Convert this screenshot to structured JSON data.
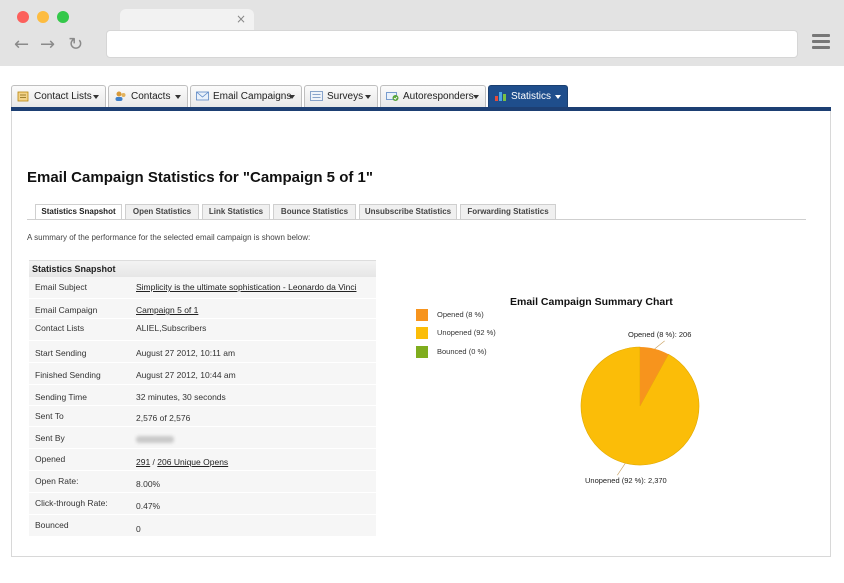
{
  "browser": {
    "tab_close": "×",
    "back_icon": "←",
    "forward_icon": "→",
    "reload_icon": "↻"
  },
  "app_tabs": [
    {
      "label": "Contact Lists",
      "icon": "contact-lists-icon"
    },
    {
      "label": "Contacts",
      "icon": "contacts-icon"
    },
    {
      "label": "Email Campaigns",
      "icon": "envelope-icon"
    },
    {
      "label": "Surveys",
      "icon": "survey-form-icon"
    },
    {
      "label": "Autoresponders",
      "icon": "autoresponder-icon"
    },
    {
      "label": "Statistics",
      "icon": "bar-chart-icon",
      "active": true
    }
  ],
  "page_title": "Email Campaign Statistics for \"Campaign 5 of 1\"",
  "sub_tabs": [
    "Statistics Snapshot",
    "Open Statistics",
    "Link Statistics",
    "Bounce Statistics",
    "Unsubscribe Statistics",
    "Forwarding Statistics"
  ],
  "summary_text": "A summary of the performance for the selected email campaign is shown below:",
  "snapshot": {
    "heading": "Statistics Snapshot",
    "rows": [
      {
        "label": "Email Subject",
        "value": "Simplicity is the ultimate sophistication - Leonardo da Vinci",
        "link": true
      },
      {
        "label": "Email Campaign",
        "value": "Campaign 5 of 1",
        "link": true
      },
      {
        "label": "Contact Lists",
        "value": "ALIEL,Subscribers"
      },
      {
        "label": "Start Sending",
        "value": "August 27 2012, 10:11 am"
      },
      {
        "label": "Finished Sending",
        "value": "August 27 2012, 10:44 am"
      },
      {
        "label": "Sending Time",
        "value": "32 minutes, 30 seconds"
      },
      {
        "label": "Sent To",
        "value": "2,576 of 2,576"
      },
      {
        "label": "Sent By",
        "value": ""
      },
      {
        "label": "Opened",
        "value_link_1": "291",
        "value_sep": " / ",
        "value_link_2": "206 Unique Opens"
      },
      {
        "label": "Open Rate:",
        "value": "8.00%"
      },
      {
        "label": "Click-through Rate:",
        "value": "0.47%"
      },
      {
        "label": "Bounced",
        "value": "0"
      }
    ]
  },
  "chart_data": {
    "type": "pie",
    "title": "Email Campaign Summary Chart",
    "legend": [
      "Opened (8 %)",
      "Unopened (92 %)",
      "Bounced (0 %)"
    ],
    "legend_position": "left",
    "slices": [
      {
        "name": "Opened",
        "value": 206,
        "percent": 8,
        "color": "#f7941d",
        "label": "Opened (8 %): 206"
      },
      {
        "name": "Unopened",
        "value": 2370,
        "percent": 92,
        "color": "#fbbd08",
        "label": "Unopened (92 %): 2,370"
      },
      {
        "name": "Bounced",
        "value": 0,
        "percent": 0,
        "color": "#7fad1e"
      }
    ]
  }
}
